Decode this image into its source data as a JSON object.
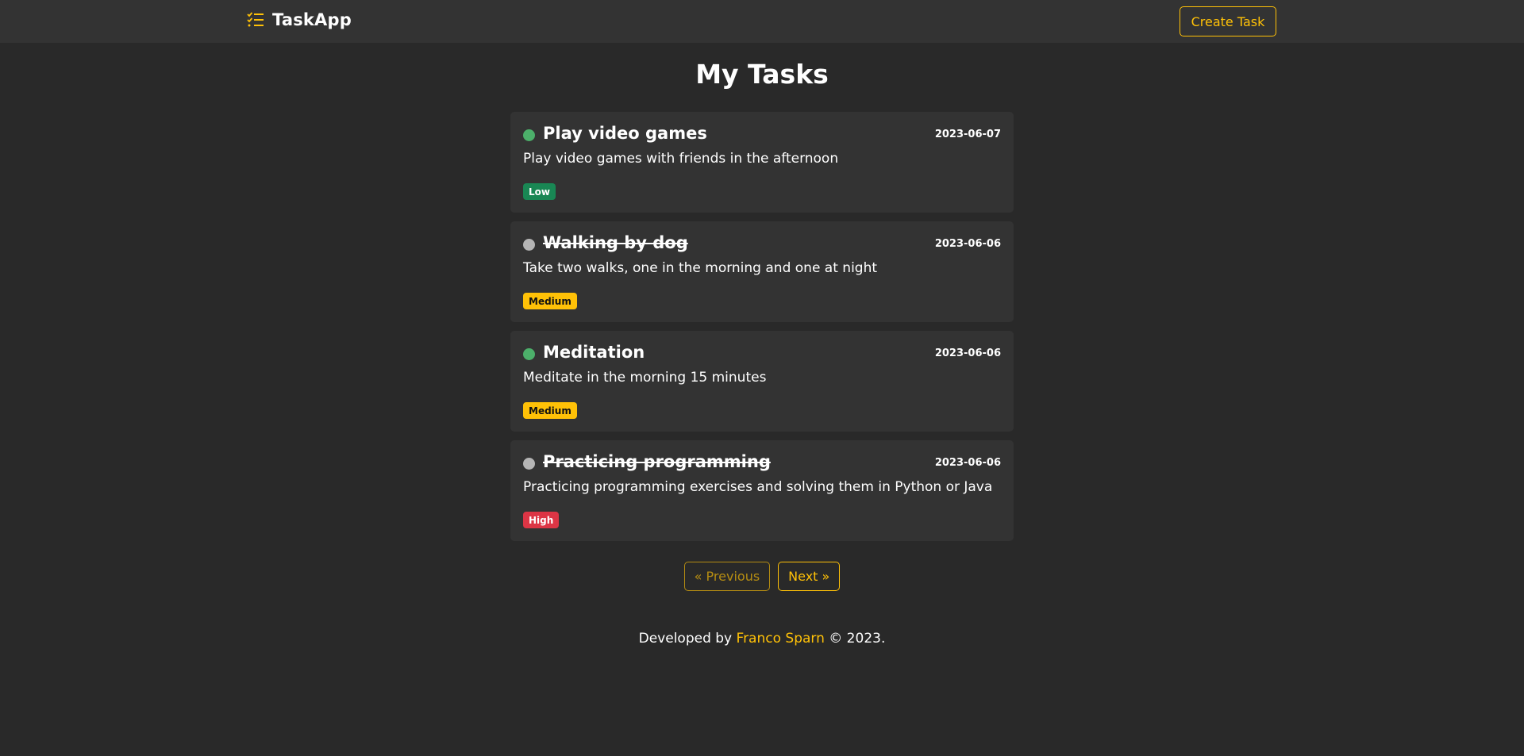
{
  "navbar": {
    "brand": "TaskApp",
    "brand_icon": "tasks-list-icon",
    "create_button": "Create Task"
  },
  "page_title": "My Tasks",
  "colors": {
    "accent": "#ffc107",
    "active_dot": "#4caf6a",
    "done_dot": "#b5b5b5",
    "low": "#198754",
    "medium": "#ffc107",
    "high": "#dc3545"
  },
  "tasks": [
    {
      "title": "Play video games",
      "date": "2023-06-07",
      "description": "Play video games with friends in the afternoon",
      "priority": "Low",
      "completed": false
    },
    {
      "title": "Walking by dog",
      "date": "2023-06-06",
      "description": "Take two walks, one in the morning and one at night",
      "priority": "Medium",
      "completed": true
    },
    {
      "title": "Meditation",
      "date": "2023-06-06",
      "description": "Meditate in the morning 15 minutes",
      "priority": "Medium",
      "completed": false
    },
    {
      "title": "Practicing programming",
      "date": "2023-06-06",
      "description": "Practicing programming exercises and solving them in Python or Java",
      "priority": "High",
      "completed": true
    }
  ],
  "pagination": {
    "previous": "« Previous",
    "next": "Next »"
  },
  "footer": {
    "prefix": "Developed by ",
    "author": "Franco Sparn",
    "suffix": " © 2023."
  }
}
